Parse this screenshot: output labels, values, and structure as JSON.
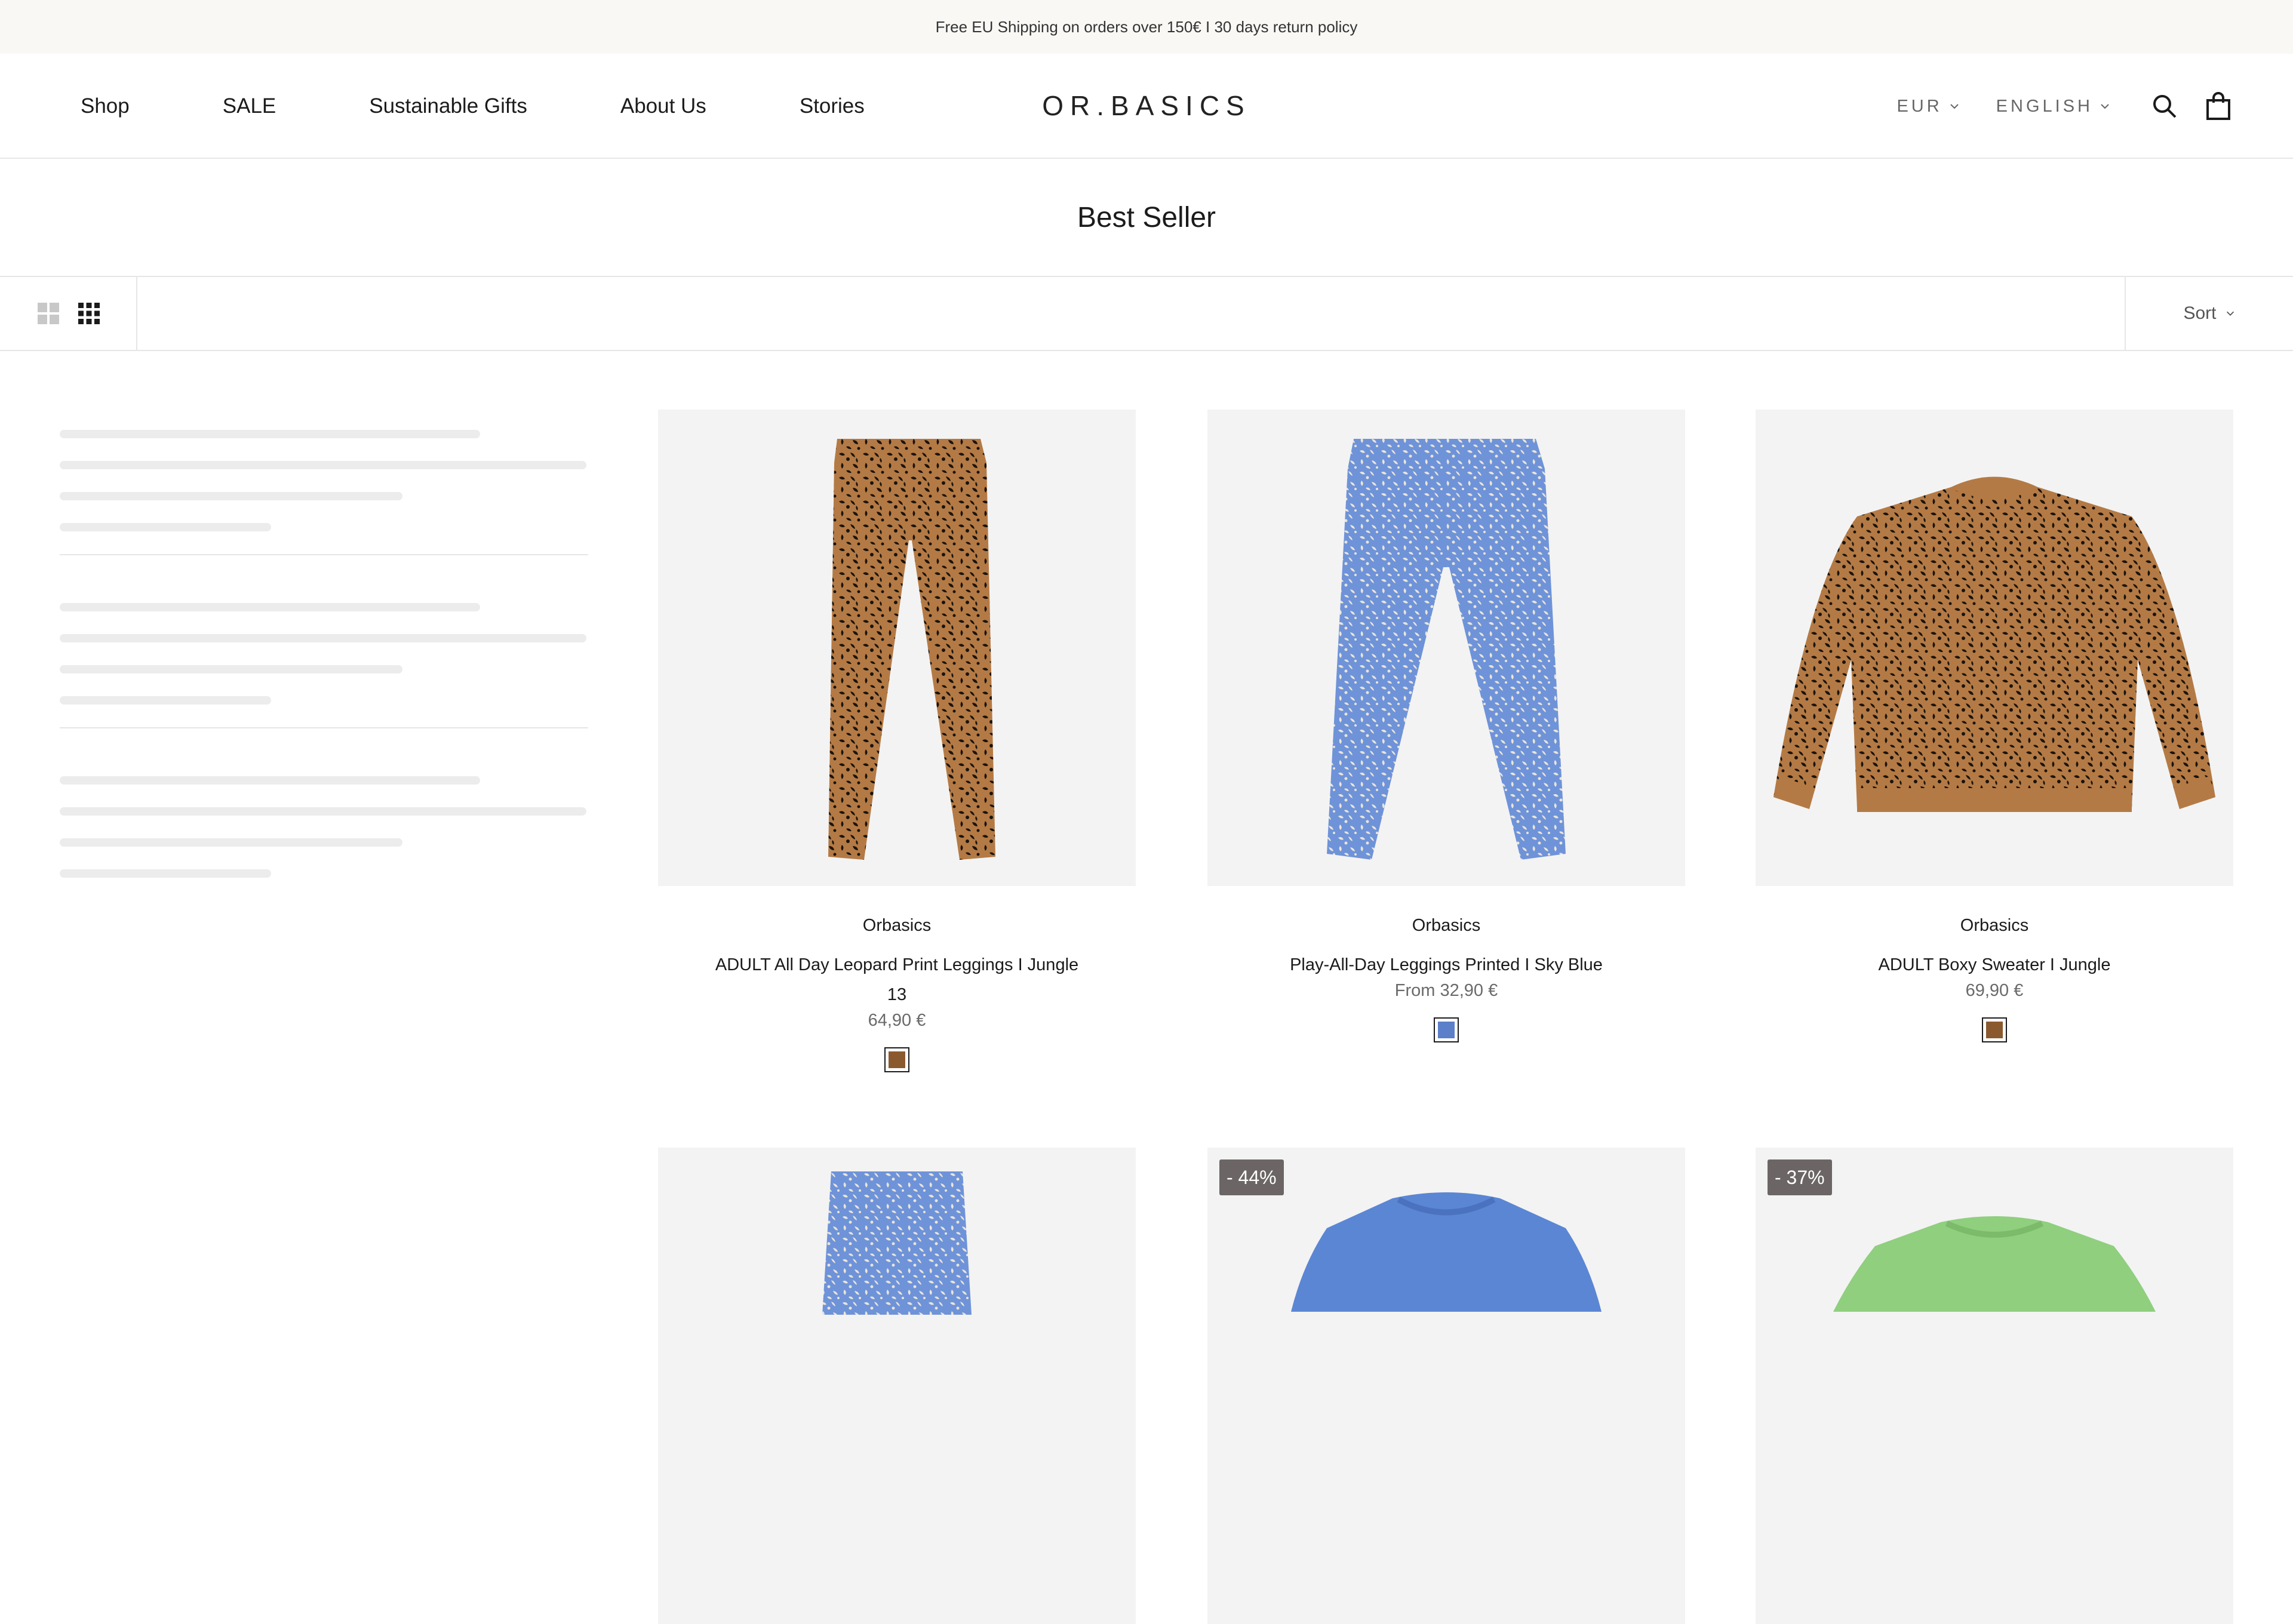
{
  "announcement": "Free EU Shipping on orders over 150€ I 30 days return policy",
  "header": {
    "nav": [
      "Shop",
      "SALE",
      "Sustainable Gifts",
      "About Us",
      "Stories"
    ],
    "logo": "OR.BASICS",
    "currency": "EUR",
    "language": "ENGLISH",
    "icons": {
      "search": "search-icon",
      "cart": "shopping-bag-icon"
    }
  },
  "collection": {
    "title": "Best Seller",
    "sort_label": "Sort",
    "layout_icons": [
      "grid-2-icon",
      "grid-3-icon"
    ]
  },
  "products": [
    {
      "vendor": "Orbasics",
      "name_line1": "ADULT All Day Leopard Print Leggings I Jungle",
      "name_line2": "13",
      "price": "64,90 €",
      "swatch_color": "#8a5a2e",
      "badge": ""
    },
    {
      "vendor": "Orbasics",
      "name_line1": "Play-All-Day Leggings Printed I Sky Blue",
      "name_line2": "",
      "price": "From 32,90 €",
      "swatch_color": "#5b7fc9",
      "badge": ""
    },
    {
      "vendor": "Orbasics",
      "name_line1": "ADULT Boxy Sweater I Jungle",
      "name_line2": "",
      "price": "69,90 €",
      "swatch_color": "#8a5a2e",
      "badge": ""
    },
    {
      "vendor": "",
      "name_line1": "",
      "name_line2": "",
      "price": "",
      "swatch_color": "#6f8fd6",
      "badge": ""
    },
    {
      "vendor": "",
      "name_line1": "",
      "name_line2": "",
      "price": "",
      "swatch_color": "#5b86d4",
      "badge": "- 44%"
    },
    {
      "vendor": "",
      "name_line1": "",
      "name_line2": "",
      "price": "",
      "swatch_color": "#8fcf7e",
      "badge": "- 37%"
    }
  ],
  "colors": {
    "announcement_bg": "#f9f8f5",
    "image_bg": "#f3f3f3",
    "badge_bg": "#6b6665",
    "leopard_base": "#b47a45",
    "sky_blue": "#6f93d8"
  }
}
